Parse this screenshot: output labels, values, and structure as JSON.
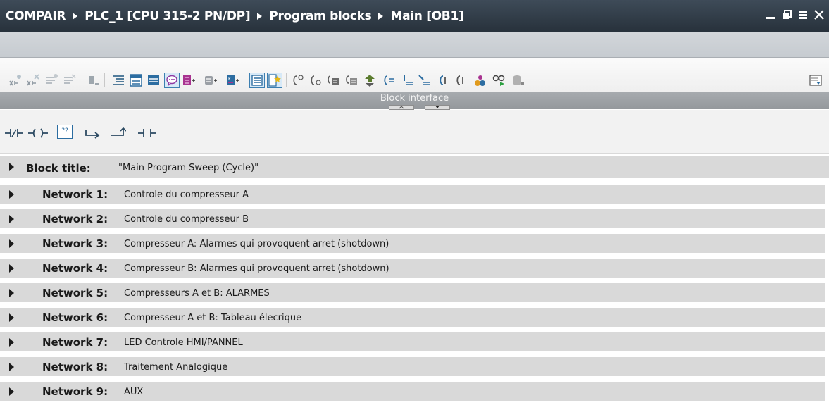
{
  "titlebar": {
    "breadcrumbs": [
      "COMPAIR",
      "PLC_1 [CPU 315-2 PN/DP]",
      "Program blocks",
      "Main [OB1]"
    ],
    "icons": [
      "minimize-icon",
      "restore-icon",
      "menu-icon",
      "close-icon"
    ]
  },
  "toolbar": {
    "icons": [
      "insert-network-icon",
      "delete-network-icon",
      "insert-row-icon",
      "delete-row-icon",
      "block-icon",
      "align-icon",
      "absolute-operands-icon",
      "favorites-icon",
      "comments-icon",
      "symbolic-addressing-icon",
      "absolute-addressing-icon",
      "symbolic-info-icon",
      "favorite-toggle-icon",
      "star-icon",
      "open-branch-icon",
      "close-branch-icon",
      "network-box-icon",
      "network-box2-icon",
      "jump-icon",
      "go-to-icon",
      "up-icon",
      "down-icon",
      "split-icon",
      "join-icon",
      "monitor-icon",
      "glasses-icon",
      "database-icon",
      "panel-icon"
    ],
    "block_interface_label": "Block interface"
  },
  "palette": {
    "icons": [
      "normally-closed-contact-icon",
      "coil-icon",
      "empty-box-icon",
      "open-branch-icon",
      "close-branch-icon",
      "normally-open-contact-icon"
    ],
    "empty_box_text": "??"
  },
  "colors": {
    "titlebar": "#2f3a45",
    "accent_blue": "#3c7fb1",
    "row_band": "#d9d9d9"
  },
  "networks": {
    "block_title_label": "Block title:",
    "block_title_value": "\"Main Program Sweep (Cycle)\"",
    "items": [
      {
        "label": "Network 1:",
        "title": "Controle du compresseur A"
      },
      {
        "label": "Network 2:",
        "title": "Controle du compresseur B"
      },
      {
        "label": "Network 3:",
        "title": "Compresseur A: Alarmes qui provoquent arret (shotdown)"
      },
      {
        "label": "Network 4:",
        "title": "Compresseur B: Alarmes qui provoquent arret (shotdown)"
      },
      {
        "label": "Network 5:",
        "title": "Compresseurs A et B: ALARMES"
      },
      {
        "label": "Network 6:",
        "title": "Compresseur A et B: Tableau élecrique"
      },
      {
        "label": "Network 7:",
        "title": "LED Controle HMI/PANNEL"
      },
      {
        "label": "Network 8:",
        "title": "Traitement Analogique"
      },
      {
        "label": "Network 9:",
        "title": "AUX"
      }
    ]
  }
}
